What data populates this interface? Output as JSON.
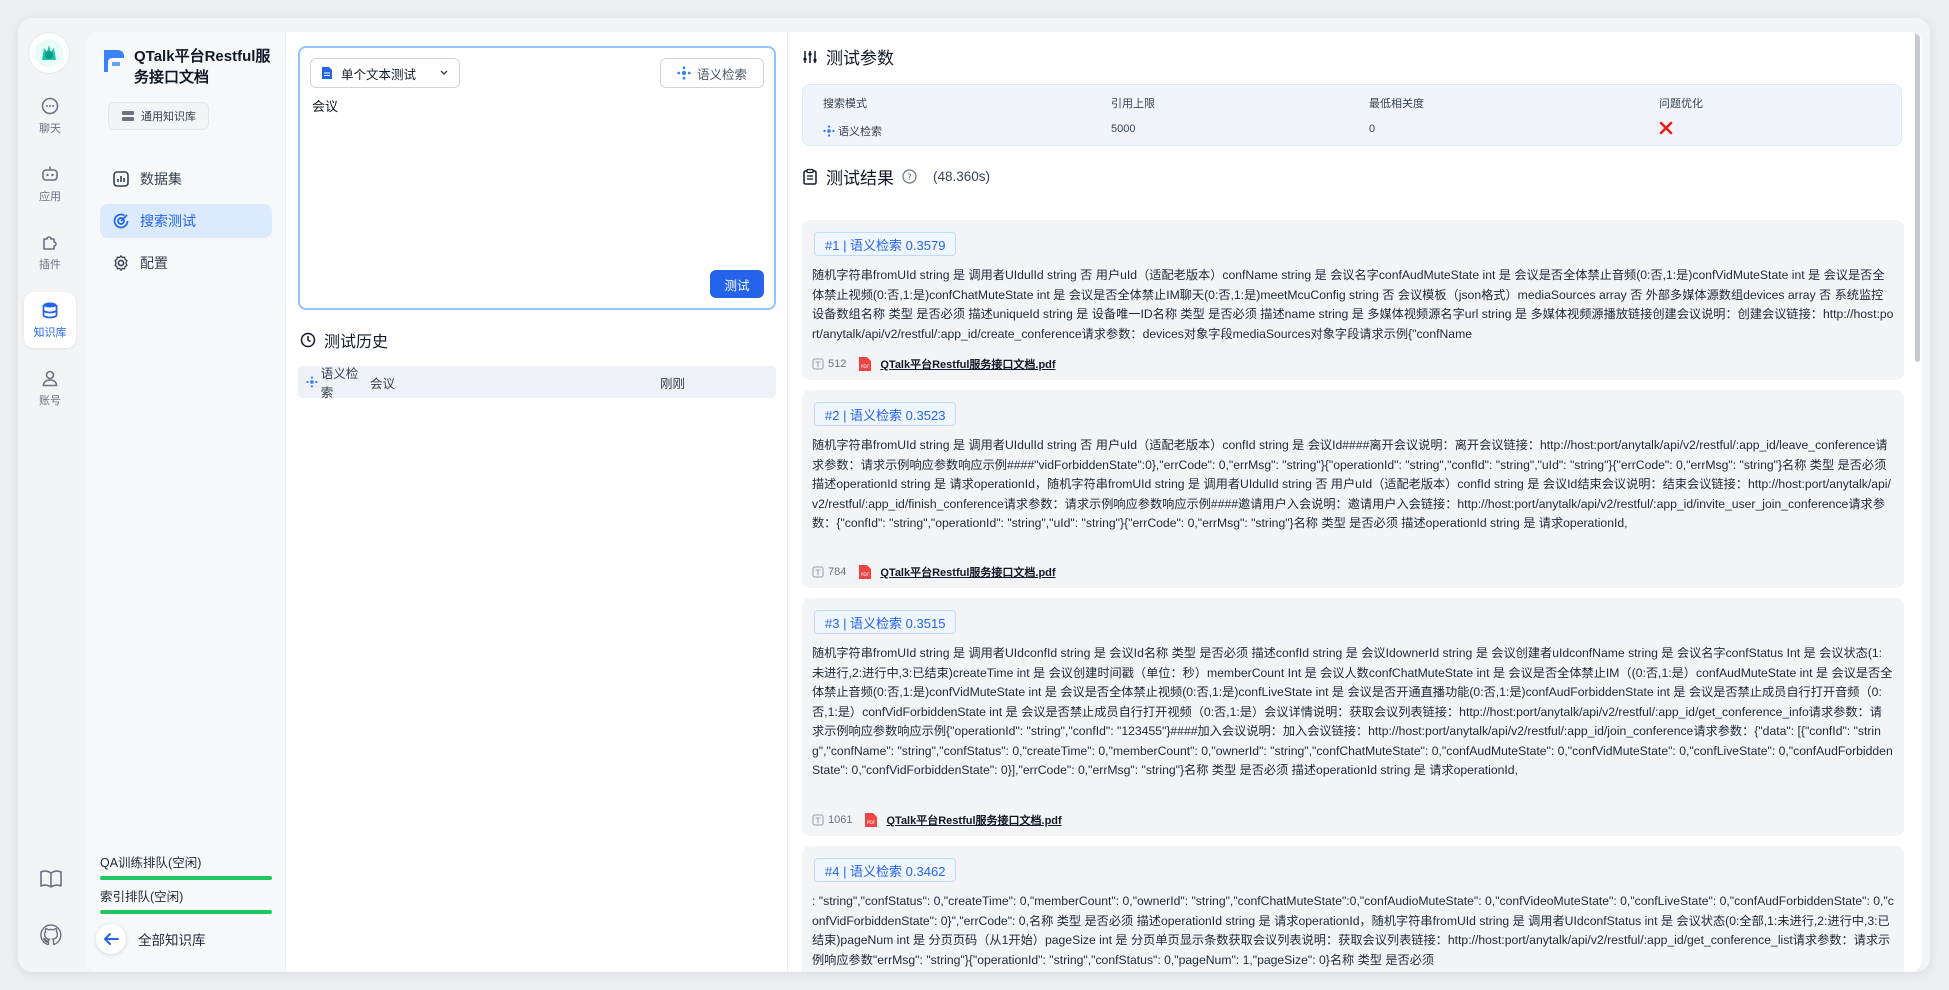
{
  "rail": {
    "items": [
      {
        "label": "聊天",
        "icon": "chat-icon"
      },
      {
        "label": "应用",
        "icon": "robot-icon"
      },
      {
        "label": "插件",
        "icon": "puzzle-icon"
      },
      {
        "label": "知识库",
        "icon": "database-icon"
      },
      {
        "label": "账号",
        "icon": "user-icon"
      }
    ]
  },
  "sidebar": {
    "title": "QTalk平台Restful服务接口文档",
    "tag": "通用知识库",
    "nav": [
      {
        "label": "数据集"
      },
      {
        "label": "搜索测试"
      },
      {
        "label": "配置"
      }
    ],
    "queues": [
      {
        "label": "QA训练排队(空闲)"
      },
      {
        "label": "索引排队(空闲)"
      }
    ],
    "back_label": "全部知识库"
  },
  "query": {
    "mode": "单个文本测试",
    "search_type": "语义检索",
    "text": "会议",
    "test_button": "测试"
  },
  "history": {
    "title": "测试历史",
    "rows": [
      {
        "mode": "语义检索",
        "text": "会议",
        "time": "刚刚"
      }
    ]
  },
  "params": {
    "title": "测试参数",
    "headers": [
      "搜索模式",
      "引用上限",
      "最低相关度",
      "问题优化"
    ],
    "mode": "语义检索",
    "limit": "5000",
    "min_relevance": "0",
    "optimization_enabled": false
  },
  "results": {
    "title": "测试结果",
    "duration": "(48.360s)",
    "items": [
      {
        "tag": "#1 | 语义检索 0.3579",
        "text": "随机字符串fromUId string 是 调用者UIdulId string 否 用户uId（适配老版本）confName string 是 会议名字confAudMuteState int 是 会议是否全体禁止音频(0:否,1:是)confVidMuteState int 是 会议是否全体禁止视频(0:否,1:是)confChatMuteState int 是 会议是否全体禁止IM聊天(0:否,1:是)meetMcuConfig string 否 会议模板（json格式）mediaSources array 否 外部多媒体源数组devices array 否 系统监控设备数组名称 类型 是否必须 描述uniqueId string 是 设备唯一ID名称 类型 是否必须 描述name string 是 多媒体视频源名字url string 是 多媒体视频源播放链接创建会议说明：创建会议链接：http://host:port/anytalk/api/v2/restful/:app_id/create_conference请求参数：devices对象字段mediaSources对象字段请求示例{\"confName",
        "tokens": "512",
        "file": "QTalk平台Restful服务接口文档.pdf"
      },
      {
        "tag": "#2 | 语义检索 0.3523",
        "text": "随机字符串fromUId string 是 调用者UIdulId string 否 用户uId（适配老版本）confId string 是 会议Id####离开会议说明：离开会议链接：http://host:port/anytalk/api/v2/restful/:app_id/leave_conference请求参数：请求示例响应参数响应示例####\"vidForbiddenState\":0},\"errCode\": 0,\"errMsg\": \"string\"}{\"operationId\": \"string\",\"confId\": \"string\",\"uId\": \"string\"}{\"errCode\": 0,\"errMsg\": \"string\"}名称 类型 是否必须 描述operationId string 是 请求operationId，随机字符串fromUId string 是 调用者UIdulId string 否 用户uId（适配老版本）confId string 是 会议Id结束会议说明：结束会议链接：http://host:port/anytalk/api/v2/restful/:app_id/finish_conference请求参数：请求示例响应参数响应示例####邀请用户入会说明：邀请用户入会链接：http://host:port/anytalk/api/v2/restful/:app_id/invite_user_join_conference请求参数：{\"confId\": \"string\",\"operationId\": \"string\",\"uId\": \"string\"}{\"errCode\": 0,\"errMsg\": \"string\"}名称 类型 是否必须 描述operationId string 是 请求operationId,",
        "tokens": "784",
        "file": "QTalk平台Restful服务接口文档.pdf"
      },
      {
        "tag": "#3 | 语义检索 0.3515",
        "text": "随机字符串fromUId string 是 调用者UIdconfId string 是 会议Id名称 类型 是否必须 描述confId string 是 会议IdownerId string 是 会议创建者uIdconfName string 是 会议名字confStatus Int 是 会议状态(1:未进行,2:进行中,3:已结束)createTime int 是 会议创建时间戳（单位：秒）memberCount Int 是 会议人数confChatMuteState int 是 会议是否全体禁止IM（(0:否,1:是）confAudMuteState int 是 会议是否全体禁止音频(0:否,1:是)confVidMuteState int 是 会议是否全体禁止视频(0:否,1:是)confLiveState int 是 会议是否开通直播功能(0:否,1:是)confAudForbiddenState int 是 会议是否禁止成员自行打开音频（0:否,1:是）confVidForbiddenState int 是 会议是否禁止成员自行打开视频（0:否,1:是）会议详情说明：获取会议列表链接：http://host:port/anytalk/api/v2/restful/:app_id/get_conference_info请求参数：请求示例响应参数响应示例{\"operationId\": \"string\",\"confId\": \"123455\"}####加入会议说明：加入会议链接：http://host:port/anytalk/api/v2/restful/:app_id/join_conference请求参数：{\"data\": [{\"confId\": \"string\",\"confName\": \"string\",\"confStatus\": 0,\"createTime\": 0,\"memberCount\": 0,\"ownerId\": \"string\",\"confChatMuteState\": 0,\"confAudMuteState\": 0,\"confVidMuteState\": 0,\"confLiveState\": 0,\"confAudForbiddenState\": 0,\"confVidForbiddenState\": 0}],\"errCode\": 0,\"errMsg\": \"string\"}名称 类型 是否必须 描述operationId string 是 请求operationId,",
        "tokens": "1061",
        "file": "QTalk平台Restful服务接口文档.pdf"
      },
      {
        "tag": "#4 | 语义检索 0.3462",
        "text": ": \"string\",\"confStatus\": 0,\"createTime\": 0,\"memberCount\": 0,\"ownerId\": \"string\",\"confChatMuteState\":0,\"confAudioMuteState\": 0,\"confVideoMuteState\": 0,\"confLiveState\": 0,\"confAudForbiddenState\": 0,\"confVidForbiddenState\": 0}\",\"errCode\": 0,名称 类型 是否必须 描述operationId string 是 请求operationId，随机字符串fromUId string 是 调用者UIdconfStatus int 是 会议状态(0:全部,1:未进行,2:进行中,3:已结束)pageNum int 是 分页页码（从1开始）pageSize int 是 分页单页显示条数获取会议列表说明：获取会议列表链接：http://host:port/anytalk/api/v2/restful/:app_id/get_conference_list请求参数：请求示例响应参数\"errMsg\": \"string\"}{\"operationId\": \"string\",\"confStatus\": 0,\"pageNum\": 1,\"pageSize\": 0}名称 类型 是否必须",
        "tokens": "",
        "file": ""
      }
    ]
  },
  "colors": {
    "accent": "#2563eb",
    "active_bg": "#dbeafe",
    "queue_bar": "#22c55e",
    "pdf_red": "#ef4444",
    "close_red": "#ef1b1b"
  }
}
